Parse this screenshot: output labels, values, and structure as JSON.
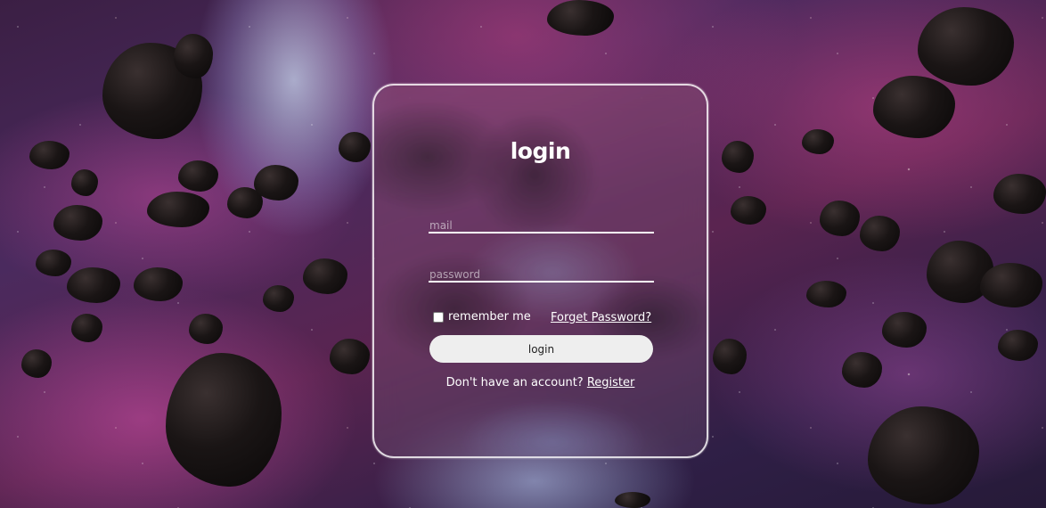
{
  "login": {
    "title": "login",
    "mail_placeholder": "mail",
    "password_placeholder": "password",
    "remember_label": "remember me",
    "forget_link": "Forget Password?",
    "submit_label": "login",
    "register_prompt": "Don't have an account?",
    "register_link": "Register"
  },
  "colors": {
    "card_border": "#ffffff",
    "button_bg": "#eeeeee",
    "text": "#ffffff"
  }
}
